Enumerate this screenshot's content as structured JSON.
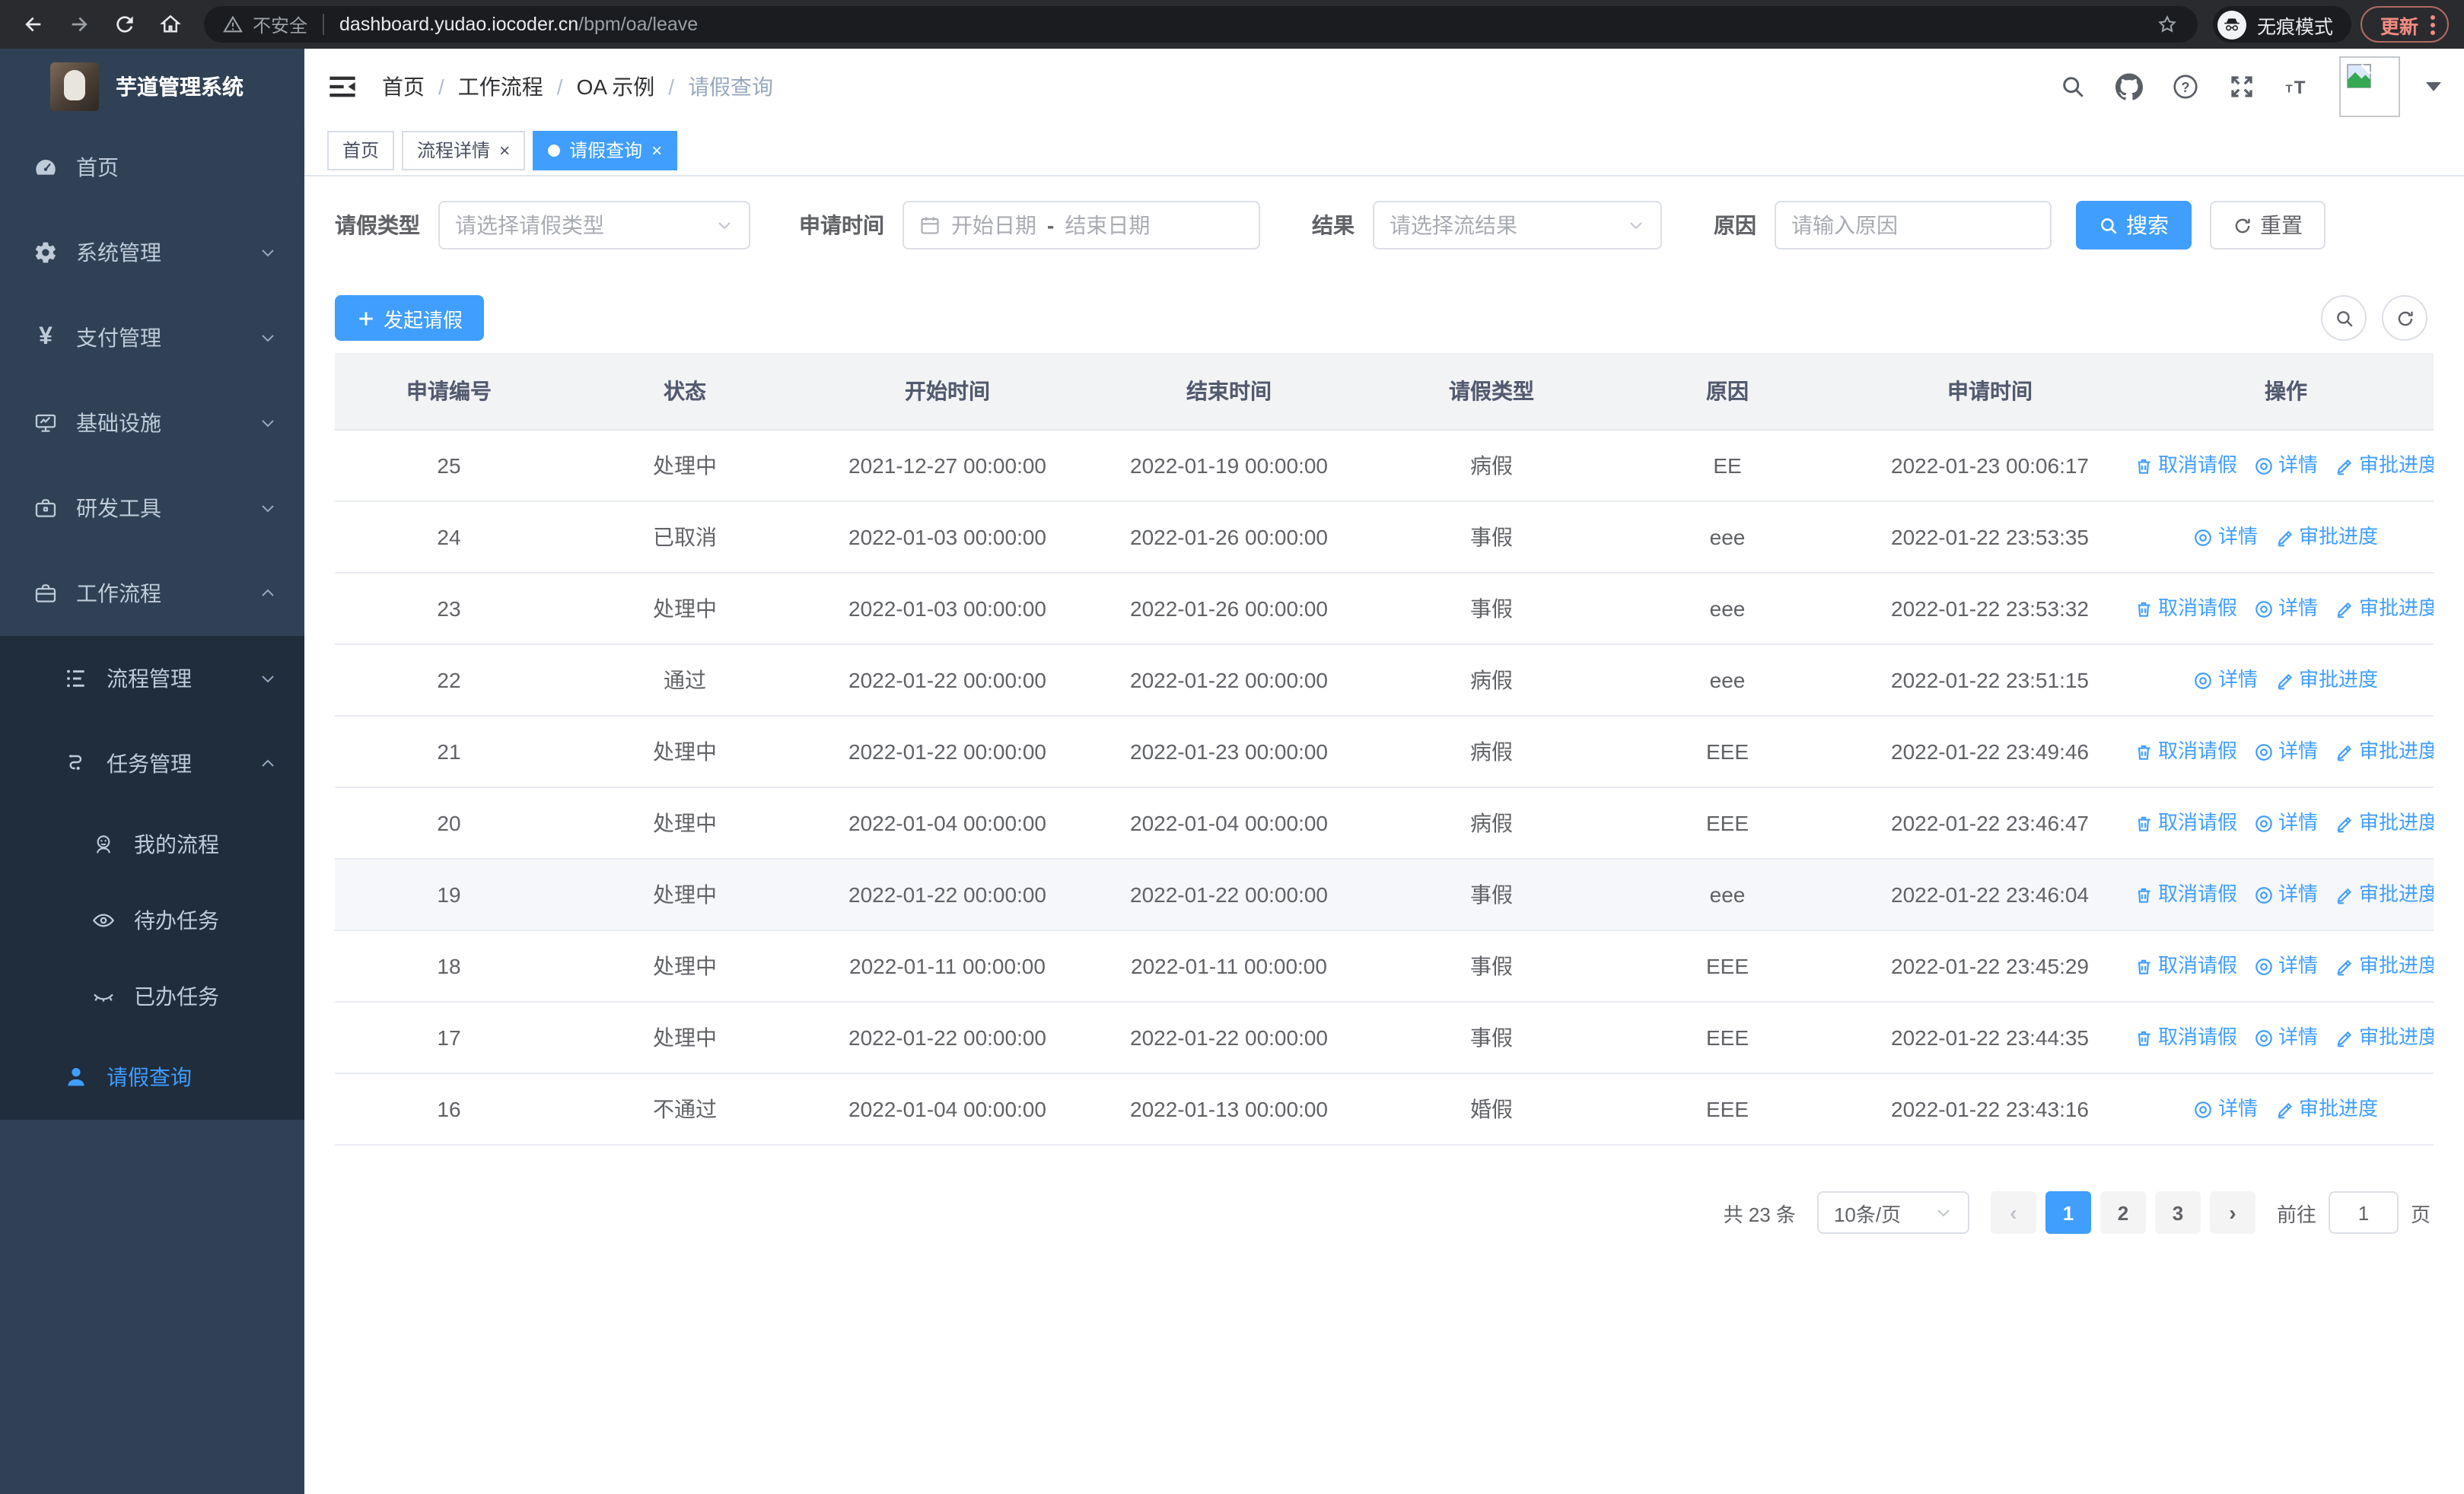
{
  "browser": {
    "security_label": "不安全",
    "url_host": "dashboard.yudao.iocoder.cn",
    "url_path": "/bpm/oa/leave",
    "incognito_label": "无痕模式",
    "update_label": "更新"
  },
  "sidebar": {
    "title": "芋道管理系统",
    "menu": [
      {
        "label": "首页"
      },
      {
        "label": "系统管理"
      },
      {
        "label": "支付管理"
      },
      {
        "label": "基础设施"
      },
      {
        "label": "研发工具"
      },
      {
        "label": "工作流程"
      },
      {
        "label": "流程管理"
      },
      {
        "label": "任务管理"
      },
      {
        "label": "我的流程"
      },
      {
        "label": "待办任务"
      },
      {
        "label": "已办任务"
      },
      {
        "label": "请假查询"
      }
    ]
  },
  "breadcrumb": {
    "items": [
      "首页",
      "工作流程",
      "OA 示例",
      "请假查询"
    ],
    "separator": "/"
  },
  "tabs": [
    {
      "label": "首页"
    },
    {
      "label": "流程详情"
    },
    {
      "label": "请假查询"
    }
  ],
  "filters": {
    "type_label": "请假类型",
    "type_placeholder": "请选择请假类型",
    "time_label": "申请时间",
    "time_start_placeholder": "开始日期",
    "time_separator": "-",
    "time_end_placeholder": "结束日期",
    "result_label": "结果",
    "result_placeholder": "请选择流结果",
    "reason_label": "原因",
    "reason_placeholder": "请输入原因",
    "search_label": "搜索",
    "reset_label": "重置"
  },
  "toolbar": {
    "create_label": "发起请假"
  },
  "table": {
    "columns": [
      "申请编号",
      "状态",
      "开始时间",
      "结束时间",
      "请假类型",
      "原因",
      "申请时间",
      "操作"
    ],
    "action_labels": {
      "cancel": "取消请假",
      "detail": "详情",
      "progress": "审批进度"
    },
    "rows": [
      {
        "id": "25",
        "status": "处理中",
        "start_time": "2021-12-27 00:00:00",
        "end_time": "2022-01-19 00:00:00",
        "type": "病假",
        "reason": "EE",
        "apply_time": "2022-01-23 00:06:17",
        "actions": [
          "cancel",
          "detail",
          "progress"
        ]
      },
      {
        "id": "24",
        "status": "已取消",
        "start_time": "2022-01-03 00:00:00",
        "end_time": "2022-01-26 00:00:00",
        "type": "事假",
        "reason": "eee",
        "apply_time": "2022-01-22 23:53:35",
        "actions": [
          "detail",
          "progress"
        ]
      },
      {
        "id": "23",
        "status": "处理中",
        "start_time": "2022-01-03 00:00:00",
        "end_time": "2022-01-26 00:00:00",
        "type": "事假",
        "reason": "eee",
        "apply_time": "2022-01-22 23:53:32",
        "actions": [
          "cancel",
          "detail",
          "progress"
        ]
      },
      {
        "id": "22",
        "status": "通过",
        "start_time": "2022-01-22 00:00:00",
        "end_time": "2022-01-22 00:00:00",
        "type": "病假",
        "reason": "eee",
        "apply_time": "2022-01-22 23:51:15",
        "actions": [
          "detail",
          "progress"
        ]
      },
      {
        "id": "21",
        "status": "处理中",
        "start_time": "2022-01-22 00:00:00",
        "end_time": "2022-01-23 00:00:00",
        "type": "病假",
        "reason": "EEE",
        "apply_time": "2022-01-22 23:49:46",
        "actions": [
          "cancel",
          "detail",
          "progress"
        ]
      },
      {
        "id": "20",
        "status": "处理中",
        "start_time": "2022-01-04 00:00:00",
        "end_time": "2022-01-04 00:00:00",
        "type": "病假",
        "reason": "EEE",
        "apply_time": "2022-01-22 23:46:47",
        "actions": [
          "cancel",
          "detail",
          "progress"
        ]
      },
      {
        "id": "19",
        "status": "处理中",
        "start_time": "2022-01-22 00:00:00",
        "end_time": "2022-01-22 00:00:00",
        "type": "事假",
        "reason": "eee",
        "apply_time": "2022-01-22 23:46:04",
        "actions": [
          "cancel",
          "detail",
          "progress"
        ]
      },
      {
        "id": "18",
        "status": "处理中",
        "start_time": "2022-01-11 00:00:00",
        "end_time": "2022-01-11 00:00:00",
        "type": "事假",
        "reason": "EEE",
        "apply_time": "2022-01-22 23:45:29",
        "actions": [
          "cancel",
          "detail",
          "progress"
        ]
      },
      {
        "id": "17",
        "status": "处理中",
        "start_time": "2022-01-22 00:00:00",
        "end_time": "2022-01-22 00:00:00",
        "type": "事假",
        "reason": "EEE",
        "apply_time": "2022-01-22 23:44:35",
        "actions": [
          "cancel",
          "detail",
          "progress"
        ]
      },
      {
        "id": "16",
        "status": "不通过",
        "start_time": "2022-01-04 00:00:00",
        "end_time": "2022-01-13 00:00:00",
        "type": "婚假",
        "reason": "EEE",
        "apply_time": "2022-01-22 23:43:16",
        "actions": [
          "detail",
          "progress"
        ]
      }
    ]
  },
  "pagination": {
    "total": "共 23 条",
    "page_size": "10条/页",
    "pages": [
      "1",
      "2",
      "3"
    ],
    "prev": "‹",
    "next": "›",
    "goto_label": "前往",
    "goto_value": "1",
    "goto_suffix": "页"
  },
  "colors": {
    "accent": "#409eff",
    "sidebar_bg": "#304156",
    "submenu_bg": "#1f2d3d",
    "update_accent": "#f28b82"
  }
}
